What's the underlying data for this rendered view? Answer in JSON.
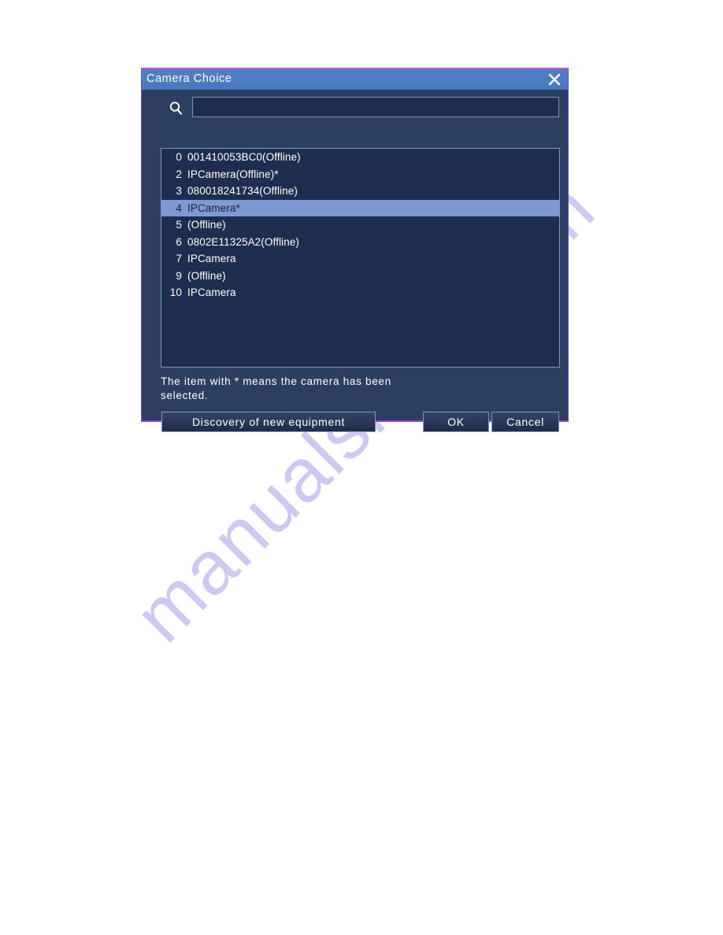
{
  "watermark": {
    "text": "manualshive.com"
  },
  "dialog": {
    "title": "Camera  Choice",
    "close_icon": "close-icon"
  },
  "search": {
    "icon": "search-icon",
    "value": "",
    "placeholder": ""
  },
  "list": {
    "items": [
      {
        "index": "0",
        "label": "001410053BC0(Offline)",
        "selected": false
      },
      {
        "index": "2",
        "label": "IPCamera(Offline)*",
        "selected": false
      },
      {
        "index": "3",
        "label": "080018241734(Offline)",
        "selected": false
      },
      {
        "index": "4",
        "label": "IPCamera*",
        "selected": true
      },
      {
        "index": "5",
        "label": "(Offline)",
        "selected": false
      },
      {
        "index": "6",
        "label": "0802E11325A2(Offline)",
        "selected": false
      },
      {
        "index": "7",
        "label": "IPCamera",
        "selected": false
      },
      {
        "index": "9",
        "label": "(Offline)",
        "selected": false
      },
      {
        "index": "10",
        "label": "IPCamera",
        "selected": false
      }
    ]
  },
  "hint": {
    "text": "The item with * means the camera has been selected."
  },
  "buttons": {
    "discovery_label": "Discovery  of  new  equipment",
    "ok_label": "OK",
    "cancel_label": "Cancel"
  },
  "colors": {
    "title_bar": "#4c7cc2",
    "dialog_background": "#2c3f63",
    "list_background": "#1e2d50",
    "selection_highlight": "#7f99d4",
    "border_top_accent": "#c74fd0",
    "border_bottom_accent": "#7b3fd6",
    "text": "#ffffff",
    "watermark": "#b9b6ef"
  }
}
